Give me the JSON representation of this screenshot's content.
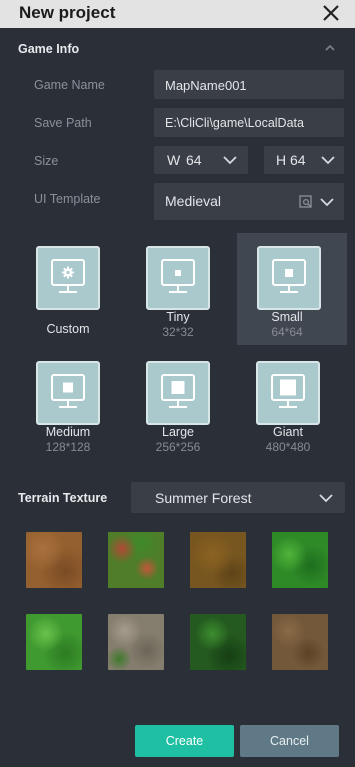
{
  "window": {
    "title": "New project"
  },
  "game_info": {
    "heading": "Game Info",
    "name_label": "Game Name",
    "name_value": "MapName001",
    "path_label": "Save Path",
    "path_value": "E:\\CliCli\\game\\LocalData",
    "size_label": "Size",
    "width_prefix": "W",
    "width_value": "64",
    "height_prefix": "H",
    "height_value": "64",
    "template_label": "UI Template",
    "template_value": "Medieval"
  },
  "sizes": [
    {
      "name": "Custom",
      "dim": ""
    },
    {
      "name": "Tiny",
      "dim": "32*32"
    },
    {
      "name": "Small",
      "dim": "64*64"
    },
    {
      "name": "Medium",
      "dim": "128*128"
    },
    {
      "name": "Large",
      "dim": "256*256"
    },
    {
      "name": "Giant",
      "dim": "480*480"
    }
  ],
  "selected_size": "Small",
  "terrain": {
    "label": "Terrain Texture",
    "value": "Summer Forest"
  },
  "buttons": {
    "create": "Create",
    "cancel": "Cancel"
  },
  "colors": {
    "accent": "#1fbfa3",
    "cancel": "#5f7a86",
    "monitor": "#a9c9cd"
  }
}
